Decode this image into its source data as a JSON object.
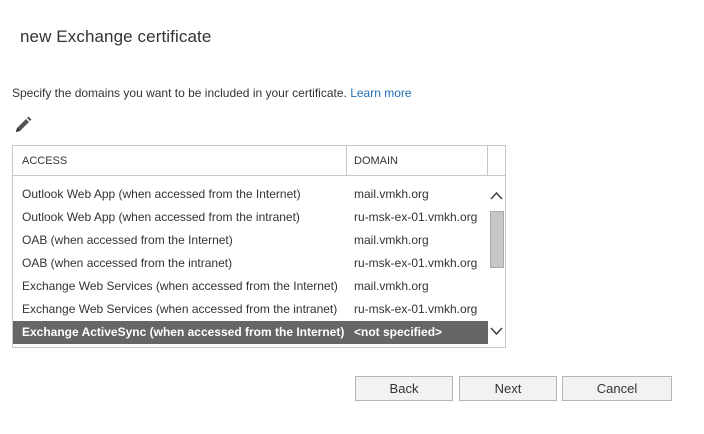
{
  "dialog": {
    "title": "new Exchange certificate",
    "description": "Specify the domains you want to be included in your certificate.",
    "learn_more": "Learn more"
  },
  "toolbar": {
    "edit_icon": "pencil-icon"
  },
  "grid": {
    "columns": [
      "ACCESS",
      "DOMAIN"
    ],
    "rows": [
      {
        "access": "Outlook Web App (when accessed from the Internet)",
        "domain": "mail.vmkh.org"
      },
      {
        "access": "Outlook Web App (when accessed from the intranet)",
        "domain": "ru-msk-ex-01.vmkh.org"
      },
      {
        "access": "OAB (when accessed from the Internet)",
        "domain": "mail.vmkh.org"
      },
      {
        "access": "OAB (when accessed from the intranet)",
        "domain": "ru-msk-ex-01.vmkh.org"
      },
      {
        "access": "Exchange Web Services (when accessed from the Internet)",
        "domain": "mail.vmkh.org"
      },
      {
        "access": "Exchange Web Services (when accessed from the intranet)",
        "domain": "ru-msk-ex-01.vmkh.org"
      },
      {
        "access": "Exchange ActiveSync (when accessed from the Internet)",
        "domain": "<not specified>"
      }
    ],
    "selected_row": 6,
    "selected_color": "#666666"
  },
  "buttons": {
    "back": "Back",
    "next": "Next",
    "cancel": "Cancel"
  },
  "colors": {
    "link": "#1f6fb5"
  }
}
